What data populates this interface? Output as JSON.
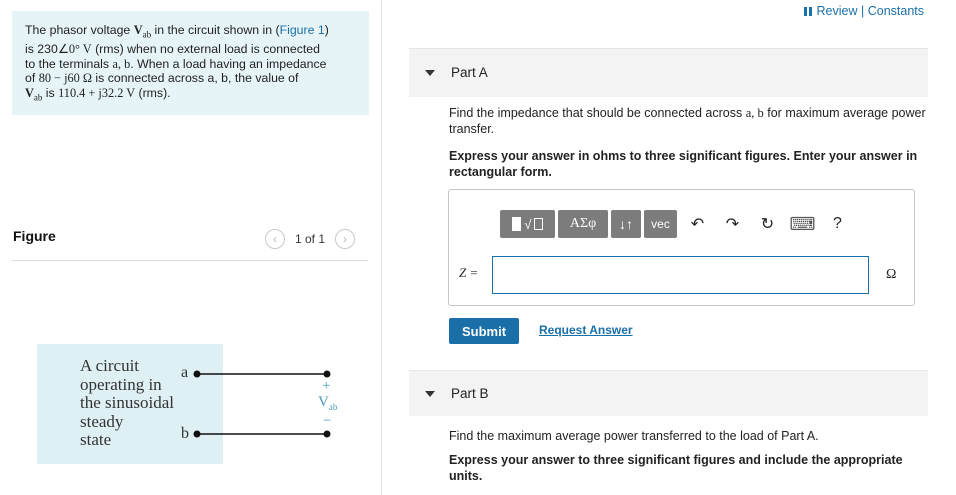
{
  "problem": {
    "line1_a": "The phasor voltage ",
    "V": "V",
    "sub_ab": "ab",
    "line1_b": " in the circuit shown in (",
    "figure_link": "Figure 1",
    "line1_c": ")",
    "line2_a": "is 230",
    "angle": "∠0°",
    "line2_b": " V",
    "line2_c": " (rms) when no external load is connected",
    "line3": "to the terminals ",
    "a": "a",
    "comma_b": ", b",
    "line3_end": ". When a load having an impedance",
    "line4_a": "of ",
    "impedance": "80 − j60 Ω",
    "line4_b": " is connected across a, b, the value of",
    "line5_val": "110.4 + j32.2 V",
    "line5_is": " is ",
    "line5_end": " (rms)."
  },
  "figure": {
    "title": "Figure",
    "counter": "1 of 1",
    "circuit_text": [
      "A circuit",
      "operating in",
      "the sinusoidal",
      "steady",
      "state"
    ],
    "terminal_a": "a",
    "terminal_b": "b",
    "plus": "+",
    "minus": "−",
    "vab": "V",
    "vab_sub": "ab"
  },
  "header": {
    "review_label": "Review | Constants"
  },
  "partA": {
    "label": "Part A",
    "prompt_a": "Find the impedance that should be connected across ",
    "prompt_ab": "a, b",
    "prompt_b": " for maximum average power transfer.",
    "instruction": "Express your answer in ohms to three significant figures. Enter your answer in rectangular form.",
    "toolbar": {
      "templates": "√",
      "greek": "ΑΣφ",
      "arrows": "↓↑",
      "vec": "vec",
      "undo": "↶",
      "redo": "↷",
      "reset": "↻",
      "keyboard": "⌨",
      "help": "?"
    },
    "input_label": "Z =",
    "input_value": "",
    "unit": "Ω",
    "submit": "Submit",
    "request": "Request Answer"
  },
  "partB": {
    "label": "Part B",
    "prompt": "Find the maximum average power transferred to the load of Part A.",
    "instruction": "Express your answer to three significant figures and include the appropriate units."
  }
}
